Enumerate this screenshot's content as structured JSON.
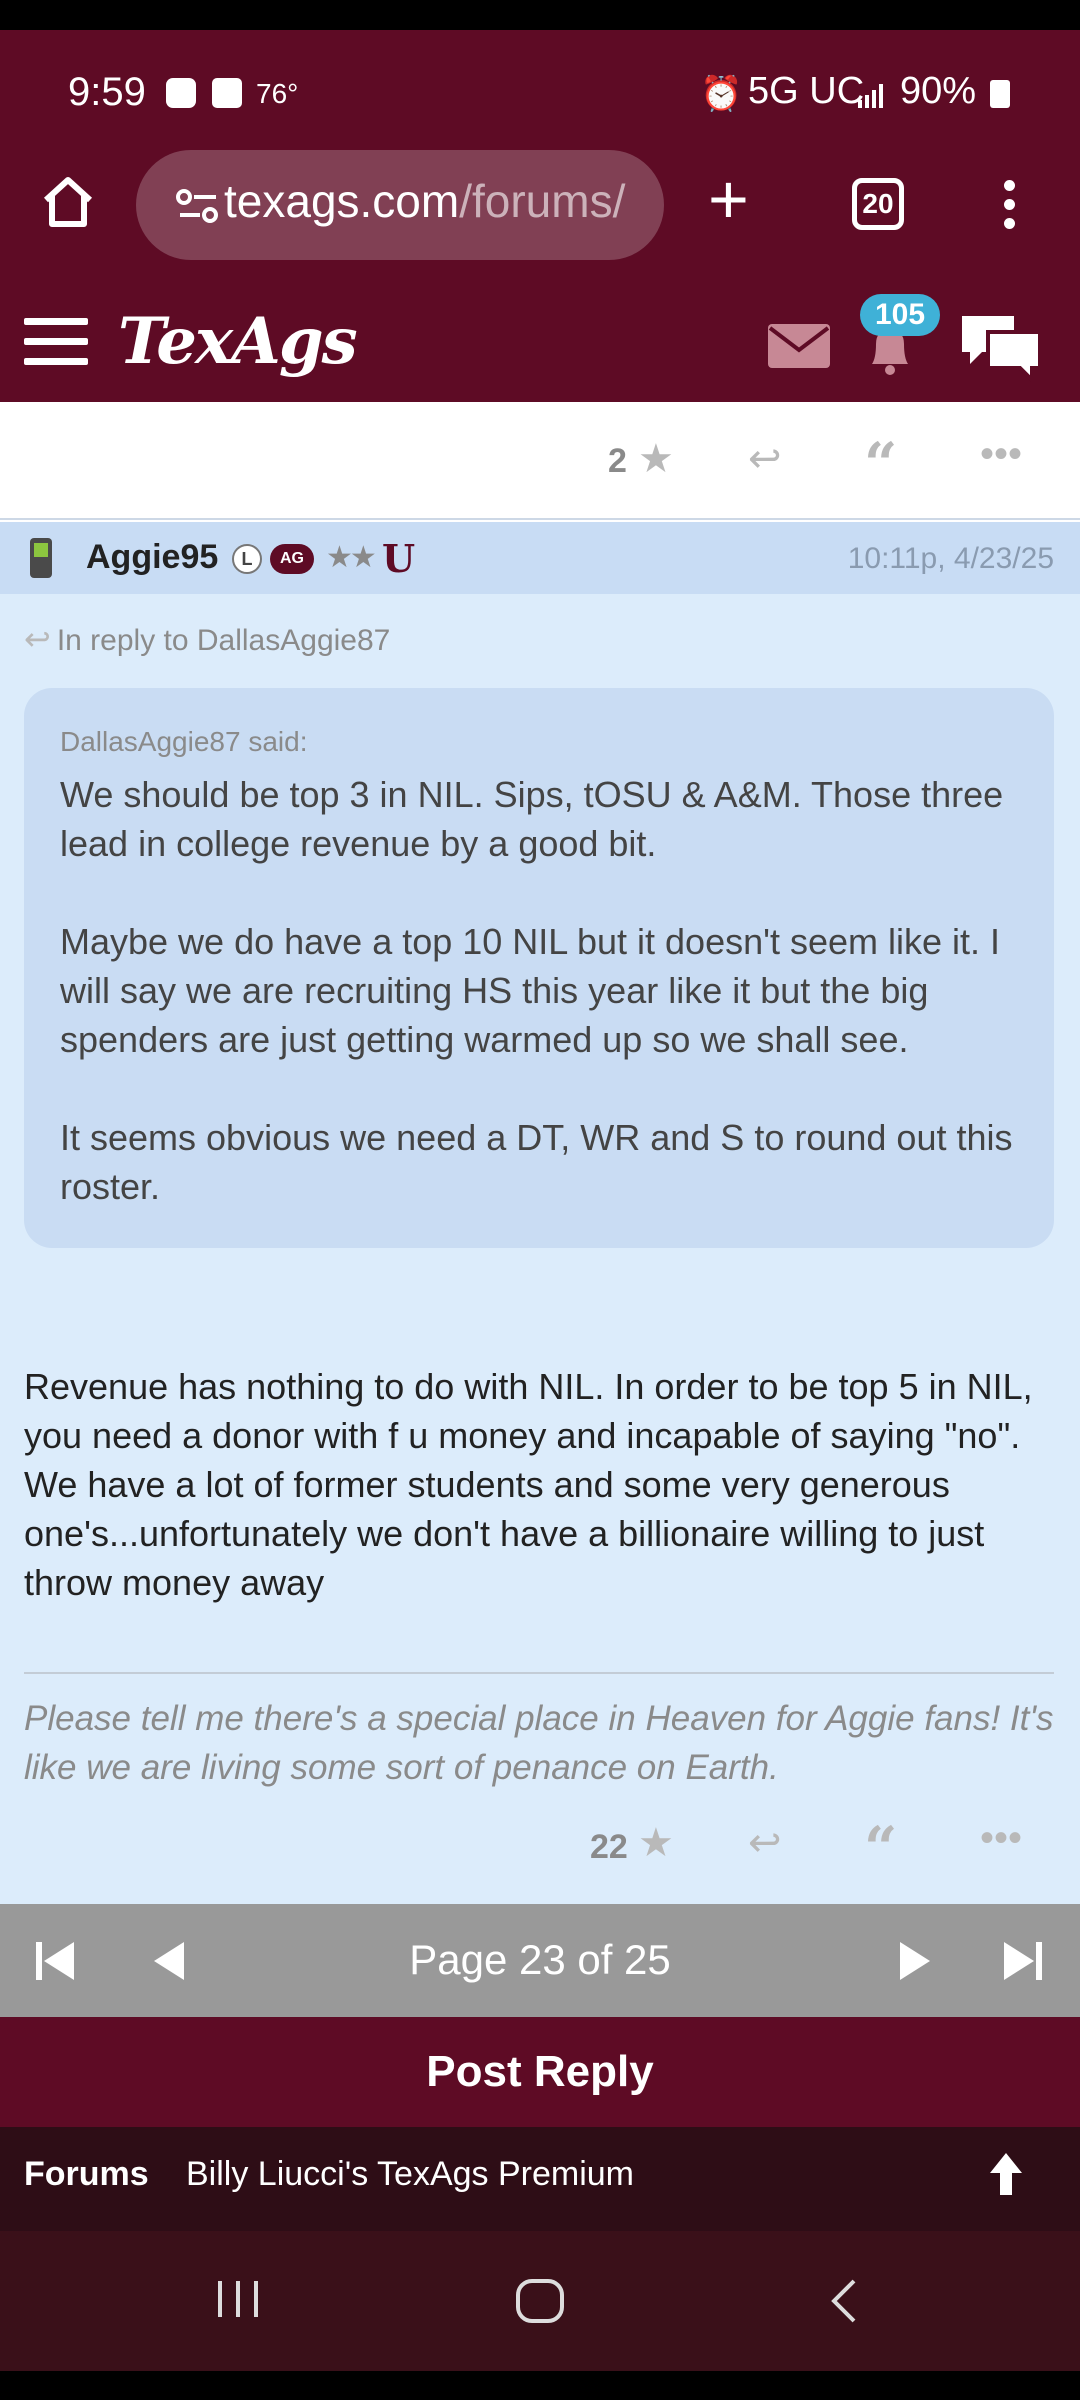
{
  "status_bar": {
    "time": "9:59",
    "temperature": "76°",
    "network": "5G UC",
    "battery": "90%"
  },
  "browser": {
    "url_main": "texags.com",
    "url_path": "/forums/",
    "tab_count": "20"
  },
  "site_header": {
    "logo": "TexAgs",
    "notification_count": "105"
  },
  "previous_post": {
    "star_count": "2"
  },
  "post": {
    "username": "Aggie95",
    "badge_l": "L",
    "badge_ag": "AG",
    "stars": "★★",
    "u_badge": "U",
    "timestamp": "10:11p, 4/23/25",
    "reply_to": "In reply to DallasAggie87",
    "quote_author": "DallasAggie87 said:",
    "quote_paragraphs": [
      "We should be top 3 in NIL. Sips, tOSU & A&M. Those three lead in college revenue by a good bit.",
      "Maybe we do have a top 10 NIL but it doesn't seem like it. I will say we are recruiting HS this year like it but the big spenders are just getting warmed up so we shall see.",
      "It seems obvious we need a DT, WR and S to round out this roster."
    ],
    "body": "Revenue has nothing to do with NIL. In order to be top 5 in NIL, you need a donor with f u money and incapable of saying \"no\". We have a lot of former students and some very generous one's...unfortunately we don't have a billionaire willing to just throw money away",
    "signature": "Please tell me there's a special place in Heaven for Aggie fans! It's like we are living some sort of penance on Earth.",
    "star_count": "22"
  },
  "pager": {
    "label": "Page 23 of 25"
  },
  "post_reply_label": "Post Reply",
  "breadcrumb": {
    "root": "Forums",
    "forum_name": "Billy Liucci's TexAgs Premium"
  },
  "colors": {
    "maroon": "#5e0b25",
    "post_bg": "#dcecfb",
    "quote_bg": "#c9dcf3",
    "badge_blue": "#3fb1d7"
  }
}
